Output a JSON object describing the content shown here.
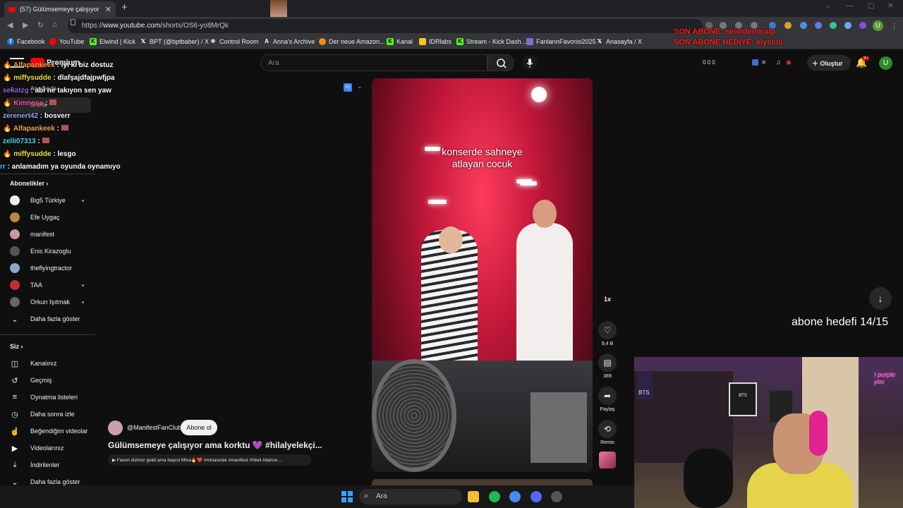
{
  "browser": {
    "tab_title": "(57) Gülümsemeye çalışıyor",
    "url_prefix": "https://",
    "url_host": "www.youtube.com",
    "url_path": "/shorts/OS6-yo8MrQk"
  },
  "bookmarks": [
    "Facebook",
    "YouTube",
    "Elwind | Kick",
    "BPT (@bptbaber) / X",
    "Control Room",
    "Anna's Archive",
    "Der neue Amazon...",
    "Kanal",
    "IDRlabs",
    "Stream - Kick Dash...",
    "FanlarınFavorisi2025",
    "Anasayfa / X"
  ],
  "stream_overlay": {
    "last_sub": "SON ABONE: selindemiralp",
    "last_gift": "SON ABONE HEDİYE: elysiuu",
    "goal": "abone hedefi 14/15"
  },
  "youtube": {
    "brand": "Premium",
    "search_placeholder": "Ara",
    "create_label": "Oluştur",
    "notif_count": "9+",
    "avatar_letter": "U",
    "counters": "0  0  0"
  },
  "chat": [
    {
      "user": "Alfapankeek",
      "text": "iyi ki biz dostuz",
      "color": "#f0a24a"
    },
    {
      "user": "miffysudde",
      "text": "dlafşajdfajpwfjpa",
      "color": "#e6e33c"
    },
    {
      "user": "sekatzg",
      "text": "abi ne takıyon sen yaw",
      "color": "#8a63d2"
    },
    {
      "user": "Kimnose",
      "text": "",
      "color": "#ff4fa3"
    },
    {
      "user": "zerenert42",
      "text": "bosverr",
      "color": "#9aa4ff"
    },
    {
      "user": "Alfapankeek",
      "text": "",
      "color": "#f0a24a"
    },
    {
      "user": "zelli07313",
      "text": "",
      "color": "#49d3e8"
    },
    {
      "user": "miffysudde",
      "text": "lesgo",
      "color": "#e6e33c"
    },
    {
      "user": "rr",
      "text": "anlamadım ya oyunda oynamıyo",
      "color": "#5ab0ff"
    }
  ],
  "sidebar": {
    "home_label": "Ana Sayfa",
    "shorts_label": "Shorts",
    "subs_header": "Abonelikler",
    "subscriptions": [
      {
        "name": "Big5 Türkiye",
        "dot": true,
        "color": "#eeeeee"
      },
      {
        "name": "Efe Uygaç",
        "dot": false,
        "color": "#b38b3c"
      },
      {
        "name": "manifest",
        "dot": false,
        "color": "#c99a9a"
      },
      {
        "name": "Enis Kirazoglu",
        "dot": false,
        "color": "#555555"
      },
      {
        "name": "theflyingtractor",
        "dot": false,
        "color": "#8fa4c9"
      },
      {
        "name": "TAA",
        "dot": true,
        "color": "#c03030"
      },
      {
        "name": "Orkun Işıtmak",
        "dot": true,
        "color": "#666666"
      }
    ],
    "show_more": "Daha fazla göster",
    "you_header": "Siz",
    "you_items": [
      {
        "label": "Kanalınız",
        "icon": "channel-icon",
        "glyph": "◫"
      },
      {
        "label": "Geçmiş",
        "icon": "history-icon",
        "glyph": "↺"
      },
      {
        "label": "Oynatma listeleri",
        "icon": "playlist-icon",
        "glyph": "≡"
      },
      {
        "label": "Daha sonra izle",
        "icon": "clock-icon",
        "glyph": "◷"
      },
      {
        "label": "Beğendiğim videolar",
        "icon": "thumbs-up-icon",
        "glyph": "👍"
      },
      {
        "label": "Videolarınız",
        "icon": "video-icon",
        "glyph": "▶"
      },
      {
        "label": "İndirilenler",
        "icon": "download-icon",
        "glyph": "⤓"
      },
      {
        "label": "Daha fazla göster",
        "icon": "chevron-down-icon",
        "glyph": "⌄"
      }
    ]
  },
  "short": {
    "caption_line1": "konserde sahneye",
    "caption_line2": "atlayan cocuk",
    "channel": "@ManifestFanClub",
    "subscribe_label": "Abone ol",
    "title": "Gülümsemeye çalışıyor ama korktu 💜 #hilalyelekçi...",
    "description": "▶ Favori dizimiz geldi ama başrol Mina🔥❤️ #minasolak #manifest #hileli #dance ...",
    "speed": "1x",
    "likes": "9,4 B",
    "comments": "389",
    "share_label": "Paylaş",
    "remix_label": "Remix"
  },
  "taskbar": {
    "search_placeholder": "Ara"
  },
  "colors": {
    "accent_red": "#ff0000",
    "link_blue": "#3ea6ff"
  }
}
